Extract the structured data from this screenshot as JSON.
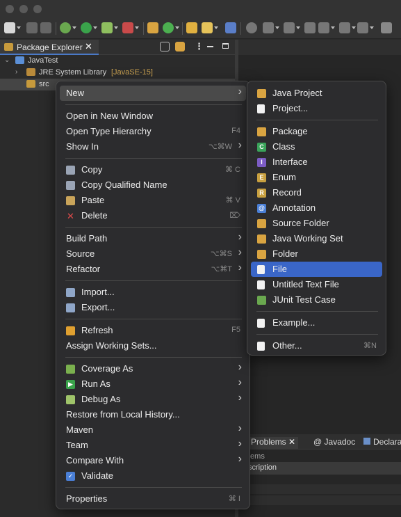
{
  "package_explorer": {
    "tab_label": "Package Explorer",
    "tree": [
      {
        "label": "JavaTest",
        "expanded": true
      },
      {
        "label": "JRE System Library",
        "suffix": "[JavaSE-15]"
      },
      {
        "label": "src"
      }
    ]
  },
  "context_menu": {
    "items": [
      {
        "label": "New",
        "submenu": true,
        "highlighted": true
      },
      {
        "separator": true
      },
      {
        "label": "Open in New Window"
      },
      {
        "label": "Open Type Hierarchy",
        "shortcut": "F4"
      },
      {
        "label": "Show In",
        "shortcut": "⌥⌘W",
        "submenu": true
      },
      {
        "separator": true
      },
      {
        "label": "Copy",
        "shortcut": "⌘ C",
        "icon": "copy-icon"
      },
      {
        "label": "Copy Qualified Name",
        "icon": "copy-qualified-icon"
      },
      {
        "label": "Paste",
        "shortcut": "⌘ V",
        "icon": "paste-icon"
      },
      {
        "label": "Delete",
        "shortcut": "⌦",
        "icon": "delete-icon"
      },
      {
        "separator": true
      },
      {
        "label": "Build Path",
        "submenu": true
      },
      {
        "label": "Source",
        "shortcut": "⌥⌘S",
        "submenu": true
      },
      {
        "label": "Refactor",
        "shortcut": "⌥⌘T",
        "submenu": true
      },
      {
        "separator": true
      },
      {
        "label": "Import...",
        "icon": "import-icon"
      },
      {
        "label": "Export...",
        "icon": "export-icon"
      },
      {
        "separator": true
      },
      {
        "label": "Refresh",
        "shortcut": "F5",
        "icon": "refresh-icon"
      },
      {
        "label": "Assign Working Sets..."
      },
      {
        "separator": true
      },
      {
        "label": "Coverage As",
        "submenu": true,
        "icon": "coverage-icon"
      },
      {
        "label": "Run As",
        "submenu": true,
        "icon": "run-icon"
      },
      {
        "label": "Debug As",
        "submenu": true,
        "icon": "debug-icon"
      },
      {
        "label": "Restore from Local History..."
      },
      {
        "label": "Maven",
        "submenu": true
      },
      {
        "label": "Team",
        "submenu": true
      },
      {
        "label": "Compare With",
        "submenu": true
      },
      {
        "label": "Validate",
        "icon": "checkbox-icon"
      },
      {
        "separator": true
      },
      {
        "label": "Properties",
        "shortcut": "⌘ I"
      }
    ]
  },
  "new_submenu": {
    "items": [
      {
        "label": "Java Project",
        "icon": "java-project-icon"
      },
      {
        "label": "Project...",
        "icon": "project-icon"
      },
      {
        "separator": true
      },
      {
        "label": "Package",
        "icon": "package-icon"
      },
      {
        "label": "Class",
        "icon": "class-icon"
      },
      {
        "label": "Interface",
        "icon": "interface-icon"
      },
      {
        "label": "Enum",
        "icon": "enum-icon"
      },
      {
        "label": "Record",
        "icon": "record-icon"
      },
      {
        "label": "Annotation",
        "icon": "annotation-icon"
      },
      {
        "label": "Source Folder",
        "icon": "source-folder-icon"
      },
      {
        "label": "Java Working Set",
        "icon": "working-set-icon"
      },
      {
        "label": "Folder",
        "icon": "folder-icon"
      },
      {
        "label": "File",
        "icon": "file-icon",
        "selected": true
      },
      {
        "label": "Untitled Text File",
        "icon": "text-file-icon"
      },
      {
        "label": "JUnit Test Case",
        "icon": "junit-icon"
      },
      {
        "separator": true
      },
      {
        "label": "Example...",
        "icon": "example-icon"
      },
      {
        "separator": true
      },
      {
        "label": "Other...",
        "shortcut": "⌘N",
        "icon": "other-icon"
      }
    ]
  },
  "bottom_panel": {
    "tabs": [
      "Problems",
      "Javadoc",
      "Declara"
    ],
    "items_label": "tems",
    "column_header": "scription"
  },
  "colors": {
    "menu_bg": "#2c2c2e",
    "selection_blue": "#3a66c8",
    "hover_gray": "#4a4a4a"
  }
}
